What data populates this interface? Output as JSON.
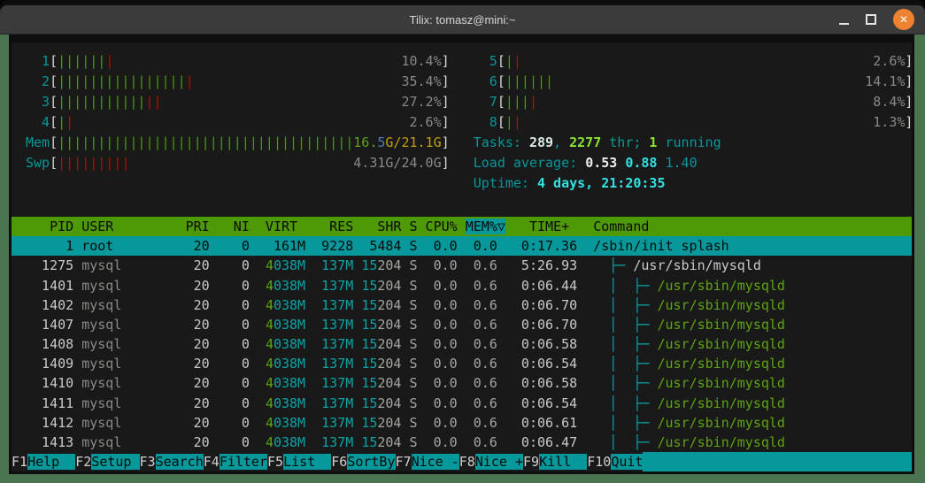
{
  "window": {
    "title": "Tilix: tomasz@mini:~"
  },
  "meters": {
    "cpus": [
      {
        "id": "1",
        "pct": "10.4%",
        "green": 6,
        "red": 1
      },
      {
        "id": "2",
        "pct": "35.4%",
        "green": 16,
        "red": 1
      },
      {
        "id": "3",
        "pct": "27.2%",
        "green": 11,
        "red": 2
      },
      {
        "id": "4",
        "pct": "2.6%",
        "green": 1,
        "red": 1
      },
      {
        "id": "5",
        "pct": "2.6%",
        "green": 1,
        "red": 1
      },
      {
        "id": "6",
        "pct": "14.1%",
        "green": 6,
        "red": 0
      },
      {
        "id": "7",
        "pct": "8.4%",
        "green": 3,
        "red": 1
      },
      {
        "id": "8",
        "pct": "1.3%",
        "green": 1,
        "red": 1
      }
    ],
    "mem": {
      "label": "Mem",
      "bars": 37,
      "seg_green": "16.",
      "seg_blue": "5",
      "seg_yellow": "G/21.1G"
    },
    "swp": {
      "label": "Swp",
      "bars": 9,
      "text": "4.31G/24.0G"
    }
  },
  "summary": {
    "tasks": {
      "label": "Tasks: ",
      "count": "289",
      "sep": ", ",
      "threads": "2277",
      "thr": " thr; ",
      "running_count": "1",
      "running": " running"
    },
    "load": {
      "label": "Load average: ",
      "v1": "0.53",
      "v2": "0.88",
      "v3": "1.40"
    },
    "uptime": {
      "label": "Uptime: ",
      "value": "4 days, 21:20:35"
    }
  },
  "table": {
    "columns": [
      "PID",
      "USER",
      "PRI",
      "NI",
      "VIRT",
      "RES",
      "SHR",
      "S",
      "CPU%",
      "MEM%",
      "TIME+",
      "Command"
    ],
    "sort_column": "MEM%",
    "header_pre": "   PID USER         PRI   NI  VIRT    RES   SHR S CPU% ",
    "header_sort": "MEM%▽",
    "header_post": "   TIME+   Command",
    "selected_row": {
      "pid": "1",
      "user": "root",
      "pri": "20",
      "ni": "0",
      "virt": "161M",
      "res": "9228",
      "shr": "5484",
      "s": "S",
      "cpu": "0.0",
      "mem": "0.0",
      "time": "0:17.36",
      "command": "/sbin/init splash"
    },
    "shared": {
      "user": "mysql",
      "pri": "20",
      "ni": "0",
      "virt_g": "4",
      "virt_m": "038M",
      "res": "137M",
      "shr_hi": "15",
      "shr_lo": "204",
      "s": "S",
      "cpu": "0.0",
      "mem": "0.6",
      "command": "/usr/sbin/mysqld"
    },
    "rows": [
      {
        "pid": "1275",
        "time": "5:26.93",
        "thread": false
      },
      {
        "pid": "1401",
        "time": "0:06.44",
        "thread": true
      },
      {
        "pid": "1402",
        "time": "0:06.70",
        "thread": true
      },
      {
        "pid": "1407",
        "time": "0:06.70",
        "thread": true
      },
      {
        "pid": "1408",
        "time": "0:06.58",
        "thread": true
      },
      {
        "pid": "1409",
        "time": "0:06.54",
        "thread": true
      },
      {
        "pid": "1410",
        "time": "0:06.58",
        "thread": true
      },
      {
        "pid": "1411",
        "time": "0:06.54",
        "thread": true
      },
      {
        "pid": "1412",
        "time": "0:06.61",
        "thread": true
      },
      {
        "pid": "1413",
        "time": "0:06.47",
        "thread": true
      }
    ],
    "tree_parent_prefix": "  ├─ ",
    "tree_child_prefix": "  │  ├─ "
  },
  "fbar": {
    "items": [
      {
        "key": "F1",
        "label": "Help  ",
        "name": "help"
      },
      {
        "key": "F2",
        "label": "Setup ",
        "name": "setup"
      },
      {
        "key": "F3",
        "label": "Search",
        "name": "search"
      },
      {
        "key": "F4",
        "label": "Filter",
        "name": "filter"
      },
      {
        "key": "F5",
        "label": "List  ",
        "name": "list"
      },
      {
        "key": "F6",
        "label": "SortBy",
        "name": "sortby"
      },
      {
        "key": "F7",
        "label": "Nice -",
        "name": "nice-minus"
      },
      {
        "key": "F8",
        "label": "Nice +",
        "name": "nice-plus"
      },
      {
        "key": "F9",
        "label": "Kill  ",
        "name": "kill"
      },
      {
        "key": "F10",
        "label": "Quit",
        "name": "quit"
      }
    ]
  },
  "colors": {
    "cyan": "#06989A",
    "bright_cyan": "#34E2E2",
    "bright_green": "#8AE234",
    "bar_green": "#4E9A06",
    "bar_red": "#CC0000",
    "green_text": "#5FA312",
    "teal_text": "#0DA3A5",
    "thr_text": "#0F9B8E",
    "yellow": "#C4A000",
    "blue": "#4E7CBF",
    "gray": "#888A85",
    "text": "#C9C9C7",
    "dim": "#A5A5A2",
    "white_bold": "#D9E8E4",
    "warm_white": "#EEEEEC",
    "bracket": "#D8D8D8",
    "black": "#0A0A0A",
    "header_bg": "#4E9A06",
    "selected_bg": "#06989A",
    "fbar_key": "#D0D0D0",
    "close_orange": "#EE8230",
    "border_green": "#4A7550",
    "term_bg": "#191919"
  },
  "close_glyph": "✕"
}
